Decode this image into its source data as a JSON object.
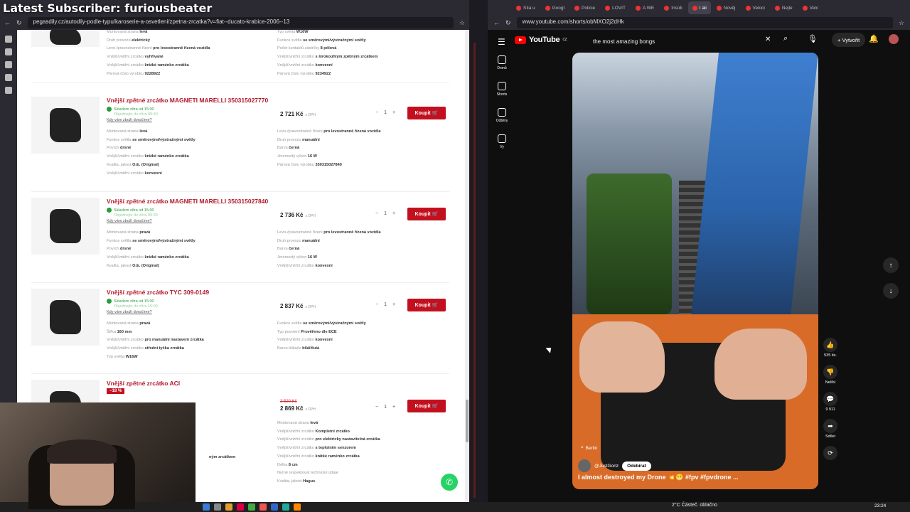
{
  "overlay": {
    "title": "Latest Subscriber: furiousbeater"
  },
  "left_browser": {
    "url": "pegasdily.cz/autodily-podle-typu/karoserie-a-osvetleni/zpetna-zrcatka?v=fiat--ducato-krabice-2006--13",
    "top_partial": {
      "specs_left": [
        [
          "Montovaná strana",
          "levá"
        ],
        [
          "Druh provozu",
          "elektrický"
        ],
        [
          "Levo-/pravostranné řízení",
          "pro levostranně řízená vozidla"
        ],
        [
          "Vnější/vnitřní zrcátko",
          "vyhřívané"
        ],
        [
          "Vnější/vnitřní zrcátko",
          "krátké raménko zrcátka"
        ],
        [
          "Párová číslo výrobku",
          "9228922"
        ]
      ],
      "specs_right": [
        [
          "Typ světla",
          "W16W"
        ],
        [
          "Funkce světla",
          "se směrovými/výstražnými světly"
        ],
        [
          "Počet kontaktů zástrčky",
          "8 pólová"
        ],
        [
          "Vnější/vnitřní zrcátko",
          "s širokoúhlým zpětným zrcátkem"
        ],
        [
          "Vnější/vnitřní zrcátko",
          "konvexní"
        ],
        [
          "Párová číslo výrobku",
          "9234922"
        ]
      ]
    },
    "products": [
      {
        "title": "Vnější zpětné zrcátko MAGNETI MARELLI 350315027770",
        "stock": "Skladem zítra od 15:00",
        "stock_sub": "Objednejte do zítra 09:30",
        "delivery_link": "Kdy vám zboží doručíme?",
        "price": "2 721 Kč",
        "vat": "s DPH",
        "qty": "1",
        "buy": "Koupit",
        "specs_left": [
          [
            "Montovaná strana",
            "levá"
          ],
          [
            "Funkce světla",
            "se směrovými/výstražnými světly"
          ],
          [
            "Povrch",
            "drsné"
          ],
          [
            "Vnější/vnitřní zrcátko",
            "krátké raménko zrcátka"
          ],
          [
            "Kvalita, jakost",
            "O.E. (Original)"
          ],
          [
            "Vnější/vnitřní zrcátko",
            "konvexní"
          ]
        ],
        "specs_right": [
          [
            "Levo-/pravostranné řízení",
            "pro levostranně řízená vozidla"
          ],
          [
            "Druh provozu",
            "manuální"
          ],
          [
            "Barva",
            "černá"
          ],
          [
            "Jmenovitý výkon",
            "16 W"
          ],
          [
            "Párová číslo výrobku",
            "350315027840"
          ]
        ]
      },
      {
        "title": "Vnější zpětné zrcátko MAGNETI MARELLI 350315027840",
        "stock": "Skladem zítra od 15:00",
        "stock_sub": "Objednejte do zítra 09:30",
        "delivery_link": "Kdy vám zboží doručíme?",
        "price": "2 736 Kč",
        "vat": "s DPH",
        "qty": "1",
        "buy": "Koupit",
        "specs_left": [
          [
            "Montovaná strana",
            "pravá"
          ],
          [
            "Funkce světla",
            "se směrovými/výstražnými světly"
          ],
          [
            "Povrch",
            "drsné"
          ],
          [
            "Vnější/vnitřní zrcátko",
            "krátké raménko zrcátka"
          ],
          [
            "Kvalita, jakost",
            "O.E. (Original)"
          ]
        ],
        "specs_right": [
          [
            "Levo-/pravostranné řízení",
            "pro levostranně řízená vozidla"
          ],
          [
            "Druh provozu",
            "manuální"
          ],
          [
            "Barva",
            "černá"
          ],
          [
            "Jmenovitý výkon",
            "16 W"
          ],
          [
            "Vnější/vnitřní zrcátko",
            "konvexní"
          ]
        ]
      },
      {
        "title": "Vnější zpětné zrcátko TYC 309-0149",
        "stock": "Skladem zítra od 15:00",
        "stock_sub": "Objednejte do zítra 15:00",
        "delivery_link": "Kdy vám zboží doručíme?",
        "price": "2 837 Kč",
        "vat": "s DPH",
        "qty": "1",
        "buy": "Koupit",
        "specs_left": [
          [
            "Montovaná strana",
            "pravá"
          ],
          [
            "Šířka",
            "160 mm"
          ],
          [
            "Vnější/vnitřní zrcátko",
            "pro manuální nastavení zrcátka"
          ],
          [
            "Vnější/vnitřní zrcátko",
            "střední tyčka zrcátka"
          ],
          [
            "Typ světla",
            "W16W"
          ]
        ],
        "specs_right": [
          [
            "Funkce světla",
            "se směrovými/výstražnými světly"
          ],
          [
            "Typ povolení",
            "Prověřeno dle ECE"
          ],
          [
            "Vnější/vnitřní zrcátko",
            "konvexní"
          ],
          [
            "Barva blikače",
            "bílá/žlutá"
          ]
        ]
      },
      {
        "title": "Vnější zpětné zrcátko ACI",
        "discount": "−18 %",
        "old_price": "3 520 Kč",
        "price": "2 869 Kč",
        "vat": "s DPH",
        "qty": "1",
        "buy": "Koupit",
        "specs_left": [
          [
            "",
            "ným zrcátkem"
          ]
        ],
        "specs_right": [
          [
            "Montovaná strana",
            "levá"
          ],
          [
            "Vnější/vnitřní zrcátko",
            "Kompletní zrcátko"
          ],
          [
            "Vnější/vnitřní zrcátko",
            "pro elektricky nastavitelná zrcátka"
          ],
          [
            "Vnější/vnitřní zrcátko",
            "s teplotním senzorem"
          ],
          [
            "Vnější/vnitřní zrcátko",
            "krátké raménko zrcátka"
          ],
          [
            "Délka",
            "8 cm"
          ],
          [
            "Nutné respektovat technické údaje",
            ""
          ],
          [
            "Kvalita, jakost",
            "Hagus"
          ]
        ]
      }
    ]
  },
  "right_browser": {
    "url": "www.youtube.com/shorts/obMXO2j2dHk",
    "tabs": [
      "Síla u",
      "Googl",
      "Policie",
      "LOVIT",
      "A WE",
      "Insídi",
      "I ali",
      "Nověj",
      "Veloci",
      "Nejle",
      "Velc"
    ],
    "youtube": {
      "logo": "YouTube",
      "logo_country": "CZ",
      "search_value": "the most amazing bongs",
      "create_label": "Vytvořit",
      "side": [
        {
          "label": "Domů",
          "icon": "home-icon"
        },
        {
          "label": "Shorts",
          "icon": "shorts-icon"
        },
        {
          "label": "Odběry",
          "icon": "subscriptions-icon"
        },
        {
          "label": "Vy",
          "icon": "profile-icon"
        }
      ],
      "short": {
        "location": "Berlin",
        "channel": "@JustGonz",
        "subscribe": "Odebírat",
        "caption": "I almost destroyed my Drone 💥😬 #fpv #fpvdrone ..."
      },
      "actions": [
        {
          "icon": "like-icon",
          "label": "535 tis."
        },
        {
          "icon": "dislike-icon",
          "label": "Nelíbí"
        },
        {
          "icon": "comment-icon",
          "label": "9 911"
        },
        {
          "icon": "share-icon",
          "label": "Sdílet"
        },
        {
          "icon": "remix-icon",
          "label": ""
        }
      ]
    }
  },
  "taskbar": {
    "weather": "2°C Částeč. oblačno",
    "time": "23:24"
  }
}
